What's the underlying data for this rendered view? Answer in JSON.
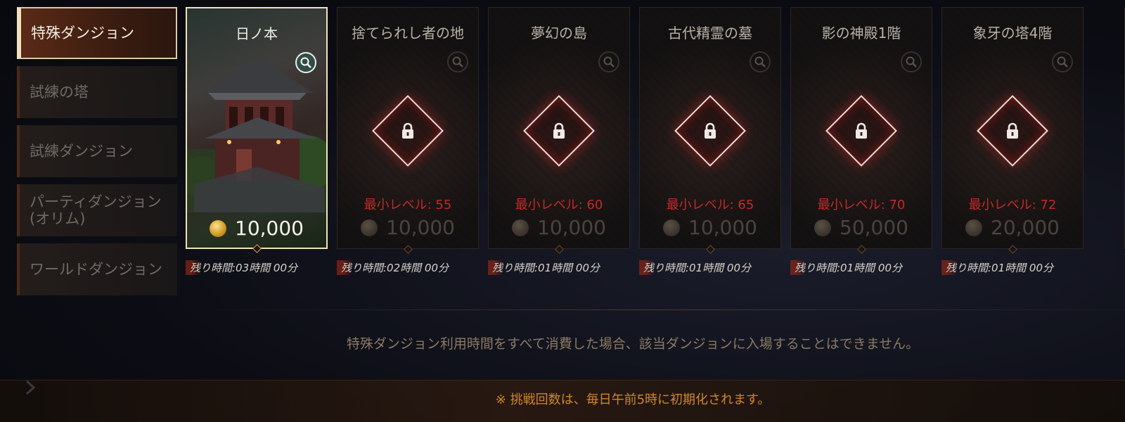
{
  "sidebar": {
    "items": [
      {
        "label": "特殊ダンジョン",
        "active": true
      },
      {
        "label": "試練の塔",
        "active": false
      },
      {
        "label": "試練ダンジョン",
        "active": false
      },
      {
        "label": "パーティダンジョン\n(オリム)",
        "active": false
      },
      {
        "label": "ワールドダンジョン",
        "active": false
      }
    ]
  },
  "dungeons": [
    {
      "title": "日ノ本",
      "locked": false,
      "min_level": "",
      "cost": "10,000",
      "remaining": "残り時間:03時間 00分"
    },
    {
      "title": "捨てられし者の地",
      "locked": true,
      "min_level": "最小レベル: 55",
      "cost": "10,000",
      "remaining": "残り時間:02時間 00分"
    },
    {
      "title": "夢幻の島",
      "locked": true,
      "min_level": "最小レベル: 60",
      "cost": "10,000",
      "remaining": "残り時間:01時間 00分"
    },
    {
      "title": "古代精霊の墓",
      "locked": true,
      "min_level": "最小レベル: 65",
      "cost": "10,000",
      "remaining": "残り時間:01時間 00分"
    },
    {
      "title": "影の神殿1階",
      "locked": true,
      "min_level": "最小レベル: 70",
      "cost": "50,000",
      "remaining": "残り時間:01時間 00分"
    },
    {
      "title": "象牙の塔4階",
      "locked": true,
      "min_level": "最小レベル: 72",
      "cost": "20,000",
      "remaining": "残り時間:01時間 00分"
    }
  ],
  "notice": "特殊ダンジョン利用時間をすべて消費した場合、該当ダンジョンに入場することはできません。",
  "reset_notice": "※ 挑戦回数は、毎日午前5時に初期化されます。",
  "colors": {
    "accent": "#d0862c",
    "level_required": "#c42a26",
    "active_border": "#efe3b8"
  }
}
